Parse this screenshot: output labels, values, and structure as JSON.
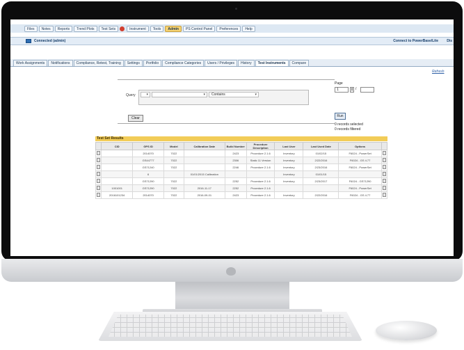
{
  "menu": {
    "tabs": [
      "Files",
      "Notes",
      "Reports",
      "Trend Plots",
      "Test Sets",
      "Instrument",
      "Tools",
      "Admin",
      "PS Control Panel",
      "Preferences",
      "Help"
    ],
    "active_tab": "Admin"
  },
  "connection": {
    "status": "Connected (admin)",
    "action_right": "Connect to PowerBase/Lite",
    "action_far_right": "Dis"
  },
  "subtabs": {
    "items": [
      "Work Assignments",
      "Notifications",
      "Compliance, Retest, Training",
      "Settings",
      "Portfolio",
      "Compliance Categories",
      "Users / Privileges",
      "History",
      "Test Instruments",
      "Compare"
    ],
    "active": "Test Instruments"
  },
  "refresh_link": "Refresh",
  "query": {
    "label": "Query",
    "operator_value": "Contains",
    "clear_label": "Clear",
    "run_label": "Run"
  },
  "paging": {
    "label": "Page",
    "current": "1",
    "of_label": "/",
    "total": ""
  },
  "records": {
    "selected": "0 records selected",
    "filtered": "0 records filtered"
  },
  "results": {
    "title": "Test Set Results",
    "columns": [
      "CID",
      "GPS ID",
      "Model",
      "Calibration Date",
      "Build Number",
      "Procedure Description",
      "Last User",
      "Last Used Date",
      "Options"
    ],
    "rows": [
      [
        "",
        "2014070",
        "7022",
        "",
        "2423",
        "Procedure 2.1.6",
        "Inventory",
        "01/02/15",
        "F6024 - PowerSet"
      ],
      [
        "",
        "GS44777",
        "7022",
        "",
        "2306",
        "Static 11 Version",
        "Inventory",
        "2/22/2016",
        "F6024 - GS 4.77"
      ],
      [
        "",
        "GS71240",
        "7022",
        "",
        "2246",
        "Procedure 2.1.6",
        "Inventory",
        "2/23/2016",
        "F6024 - PowerSet"
      ],
      [
        "",
        "6",
        "",
        "01/01/2015 Calibration",
        "",
        "",
        "Inventory",
        "01/01/15",
        ""
      ],
      [
        "",
        "GS71290",
        "7022",
        "",
        "2252",
        "Procedure 2.1.6",
        "Inventory",
        "2/23/2017",
        "F6024 - GS71290"
      ],
      [
        "1001001",
        "GS71290",
        "7022",
        "2016-11-17",
        "2252",
        "Procedure 2.1.6",
        "",
        "",
        "F6024 - PowerSet"
      ],
      [
        "2016101234",
        "2014070",
        "7022",
        "2016-09-01",
        "2423",
        "Procedure 2.1.6",
        "Inventory",
        "2/22/2016",
        "F6024 - GS 4.77"
      ]
    ]
  },
  "colors": {
    "active_tab": "#f5d271",
    "results_header": "#f2cc58",
    "link": "#2d5fa6"
  }
}
